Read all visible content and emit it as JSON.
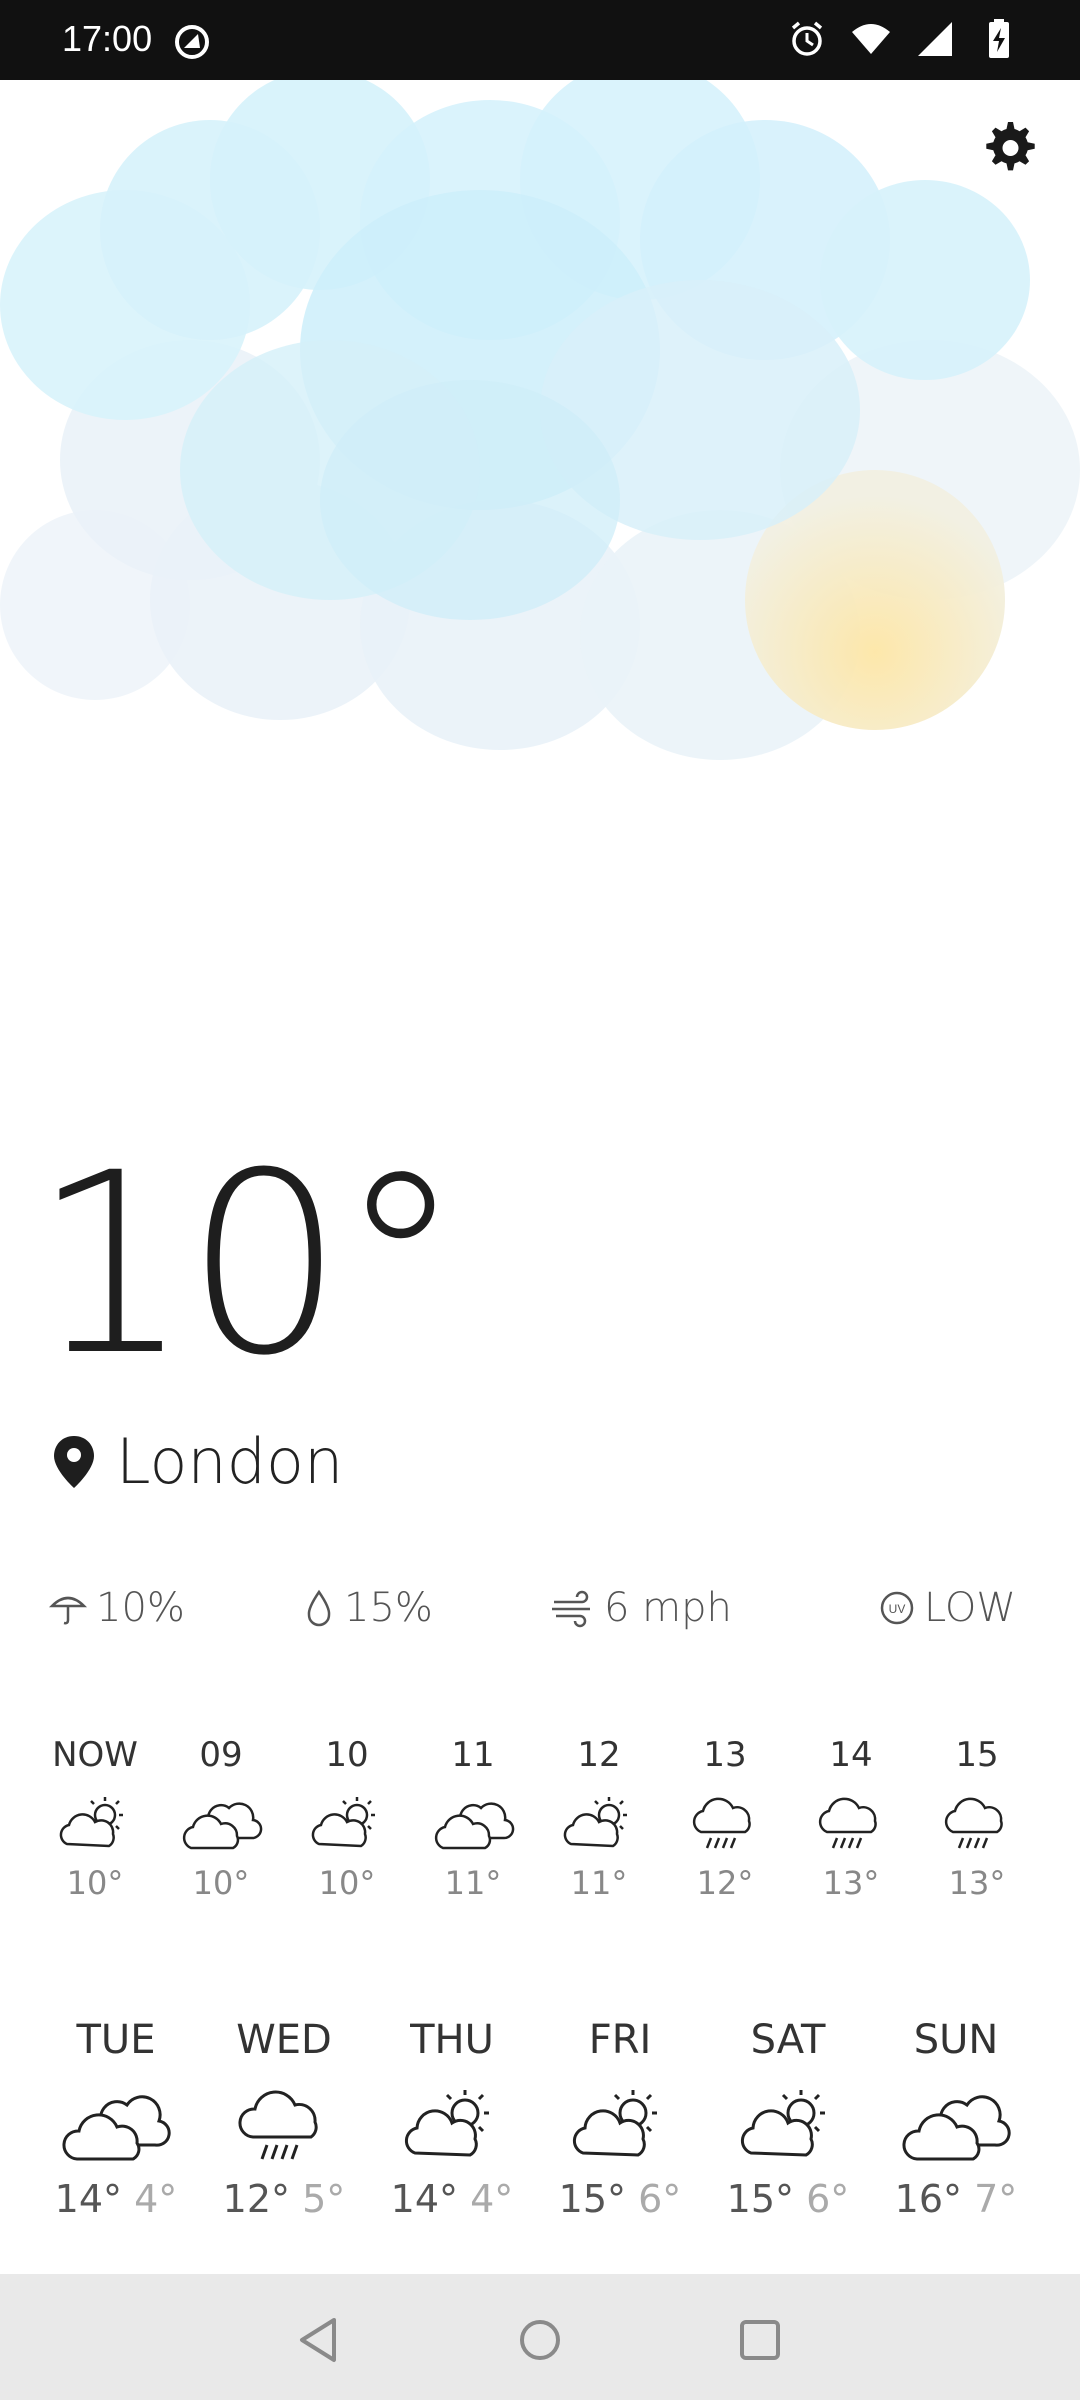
{
  "status_bar": {
    "time": "17:00",
    "icons": [
      "app-notification-icon",
      "alarm-icon",
      "wifi-icon",
      "signal-icon",
      "battery-charging-icon"
    ]
  },
  "colors": {
    "cloud_light": "#d6f3fb",
    "cloud_pale": "#e9f2f8",
    "sun": "#fbe9b8",
    "text_dark": "#1e1e1e",
    "text_muted": "#888888"
  },
  "current": {
    "temperature": "10°",
    "location": "London"
  },
  "details": {
    "precipitation": "10%",
    "humidity": "15%",
    "wind": "6 mph",
    "uv": "LOW"
  },
  "hourly": [
    {
      "label": "NOW",
      "icon": "partly-cloudy-icon",
      "temp": "10°"
    },
    {
      "label": "09",
      "icon": "cloudy-icon",
      "temp": "10°"
    },
    {
      "label": "10",
      "icon": "partly-cloudy-icon",
      "temp": "10°"
    },
    {
      "label": "11",
      "icon": "cloudy-icon",
      "temp": "11°"
    },
    {
      "label": "12",
      "icon": "partly-cloudy-icon",
      "temp": "11°"
    },
    {
      "label": "13",
      "icon": "rain-icon",
      "temp": "12°"
    },
    {
      "label": "14",
      "icon": "rain-icon",
      "temp": "13°"
    },
    {
      "label": "15",
      "icon": "rain-icon",
      "temp": "13°"
    }
  ],
  "daily": [
    {
      "label": "TUE",
      "icon": "cloudy-icon",
      "high": "14°",
      "low": "4°"
    },
    {
      "label": "WED",
      "icon": "rain-icon",
      "high": "12°",
      "low": "5°"
    },
    {
      "label": "THU",
      "icon": "partly-cloudy-icon",
      "high": "14°",
      "low": "4°"
    },
    {
      "label": "FRI",
      "icon": "partly-cloudy-icon",
      "high": "15°",
      "low": "6°"
    },
    {
      "label": "SAT",
      "icon": "partly-cloudy-icon",
      "high": "15°",
      "low": "6°"
    },
    {
      "label": "SUN",
      "icon": "cloudy-icon",
      "high": "16°",
      "low": "7°"
    }
  ],
  "navbar": {
    "buttons": [
      "back-icon",
      "home-icon",
      "recents-icon"
    ]
  }
}
